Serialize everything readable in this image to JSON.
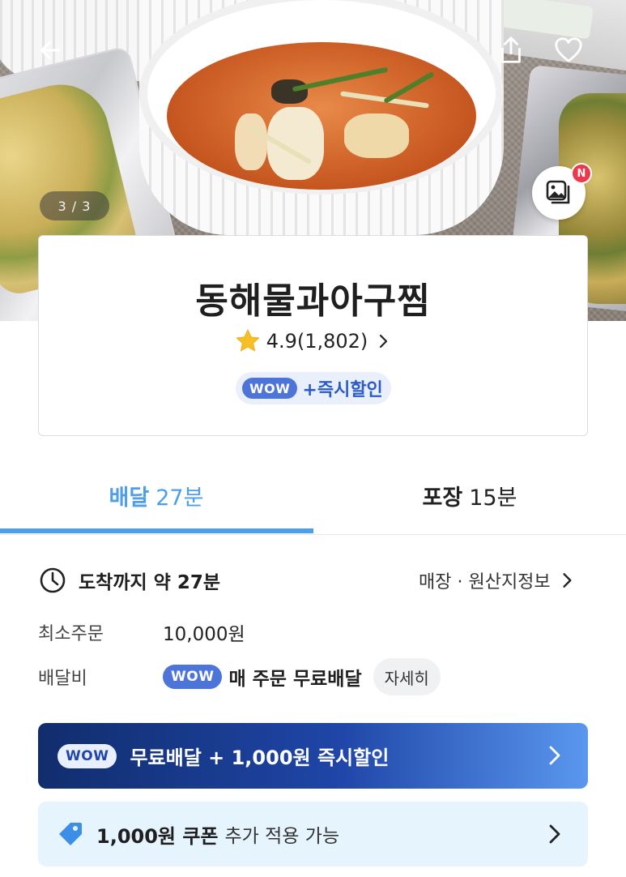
{
  "hero": {
    "pager": "3 / 3",
    "new_badge": "N"
  },
  "icons": {
    "back": "arrow-left-icon",
    "search": "search-icon",
    "share": "share-icon",
    "favorite": "heart-icon",
    "gallery": "photo-gallery-icon",
    "rating": "star-icon",
    "clock": "clock-icon",
    "coupon": "coupon-tag-icon"
  },
  "store": {
    "name": "동해물과아구찜",
    "rating": "4.9",
    "review_count": "(1,802)",
    "wow_label": "WOW",
    "promo": "+즉시할인"
  },
  "tabs": [
    {
      "label": "배달",
      "time": "27분"
    },
    {
      "label": "포장",
      "time": "15분"
    }
  ],
  "delivery": {
    "arrival": "도착까지 약 27분",
    "store_info_link": "매장 · 원산지정보",
    "min_order_label": "최소주문",
    "min_order_value": "10,000원",
    "fee_label": "배달비",
    "fee_wow": "WOW",
    "fee_text": "매 주문 무료배달",
    "detail_button": "자세히"
  },
  "banners": {
    "wow_tag": "WOW",
    "wow_text": "무료배달 + 1,000원 즉시할인",
    "coupon_amount": "1,000원 쿠폰",
    "coupon_rest": "추가 적용 가능"
  },
  "colors": {
    "accent": "#4f9ee8",
    "wow": "#4d74d9",
    "banner_dark": "#112d6d",
    "coupon_bg": "#e6f4fd"
  }
}
